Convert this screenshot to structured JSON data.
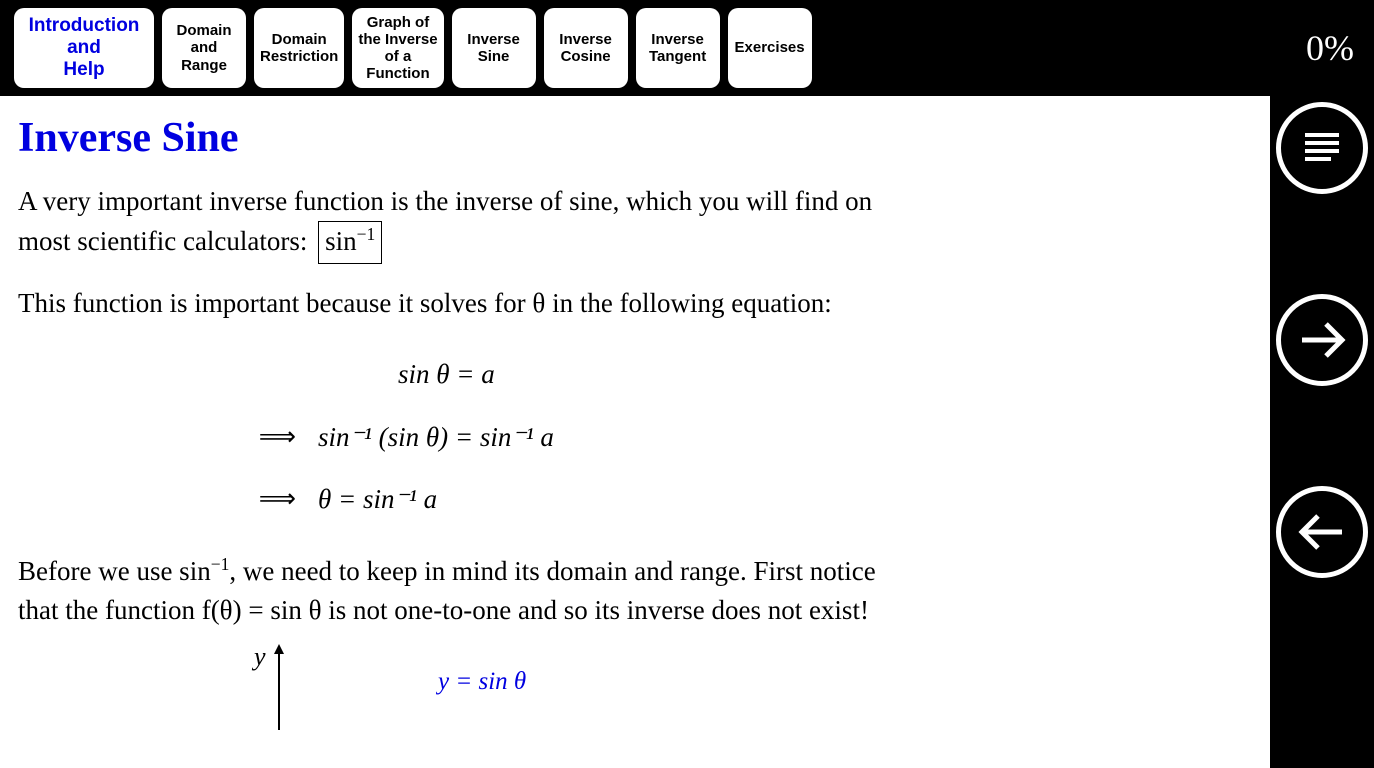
{
  "progress": "0%",
  "tabs": [
    {
      "label": "Introduction\nand\nHelp",
      "active": true,
      "wide": true
    },
    {
      "label": "Domain\nand\nRange"
    },
    {
      "label": "Domain\nRestriction"
    },
    {
      "label": "Graph of\nthe Inverse\nof a\nFunction"
    },
    {
      "label": "Inverse\nSine"
    },
    {
      "label": "Inverse\nCosine"
    },
    {
      "label": "Inverse\nTangent"
    },
    {
      "label": "Exercises"
    }
  ],
  "page": {
    "title": "Inverse Sine",
    "para1_a": "A very important inverse function is the inverse of sine, which you will find on most scientific calculators:",
    "para1_box": "sin",
    "para1_exp": "−1",
    "para2": "This function is important because it solves for θ in the following equation:",
    "eq1": "sin θ = a",
    "eq2_arrow": "⟹",
    "eq2": "sin⁻¹ (sin θ) = sin⁻¹ a",
    "eq3_arrow": "⟹",
    "eq3": "θ = sin⁻¹ a",
    "para3_a": "Before we use sin",
    "para3_exp": "−1",
    "para3_b": ", we need to keep in mind its domain and range. First notice that the function f(θ) = sin θ is not one-to-one and so its inverse does not exist!",
    "graph_ylabel": "y",
    "graph_expr": "y = sin θ"
  },
  "sidebar": {
    "menu": "menu",
    "next": "next",
    "prev": "previous"
  }
}
